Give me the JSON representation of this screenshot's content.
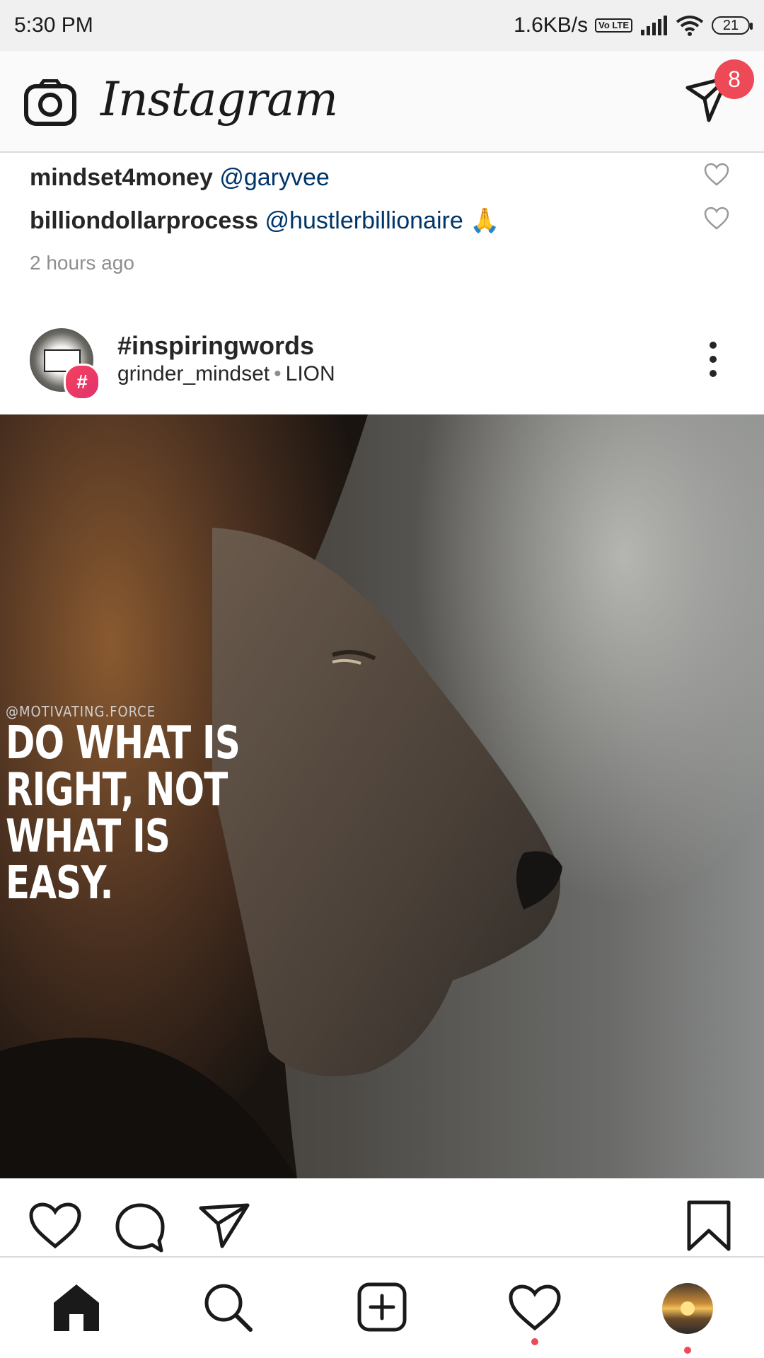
{
  "status_bar": {
    "time": "5:30 PM",
    "speed": "1.6KB/s",
    "volte": "Vo LTE",
    "battery": "21"
  },
  "header": {
    "app_name": "Instagram",
    "dm_badge": "8"
  },
  "comments": [
    {
      "user": "mindset4money",
      "text": "@garyvee"
    },
    {
      "user": "billiondollarprocess",
      "text": "@hustlerbillionaire 🙏"
    }
  ],
  "time_ago": "2 hours ago",
  "post": {
    "title": "#inspiringwords",
    "username": "grinder_mindset",
    "separator": "•",
    "location": "LION",
    "avatar_badge": "#",
    "image": {
      "watermark": "@MOTIVATING.FORCE",
      "quote_lines": [
        "DO WHAT IS",
        "RIGHT, NOT",
        "WHAT IS",
        "EASY."
      ]
    }
  },
  "icons": {
    "camera": "camera-icon",
    "direct": "direct-message-icon",
    "like": "heart-icon",
    "comment": "comment-icon",
    "share": "share-icon",
    "save": "bookmark-icon",
    "more": "more-options-icon",
    "home": "home-icon",
    "search": "search-icon",
    "add": "add-post-icon",
    "activity": "activity-heart-icon"
  },
  "colors": {
    "notification": "#ed4956",
    "mention": "#003569",
    "secondary_text": "#8e8e8e"
  }
}
